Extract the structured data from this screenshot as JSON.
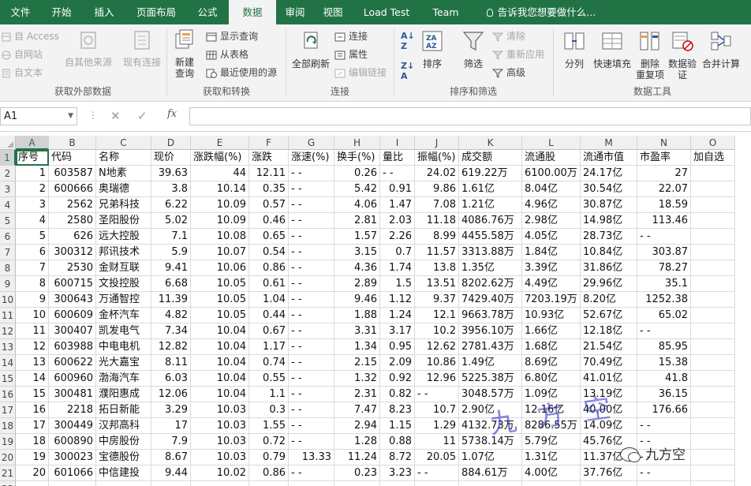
{
  "tabs": [
    "文件",
    "开始",
    "插入",
    "页面布局",
    "公式",
    "数据",
    "审阅",
    "视图",
    "Load Test",
    "Team"
  ],
  "active_tab": "数据",
  "tell_me": "告诉我您想要做什么...",
  "ribbon": {
    "get_external": {
      "access": "自 Access",
      "web": "自网站",
      "text": "自文本",
      "other_sources": "自其他来源",
      "existing_conn": "现有连接",
      "group_label": "获取外部数据"
    },
    "get_transform": {
      "new_query_line1": "新建",
      "new_query_line2": "查询",
      "show_queries": "显示查询",
      "from_table": "从表格",
      "recent_sources": "最近使用的源",
      "group_label": "获取和转换"
    },
    "connections": {
      "refresh_all": "全部刷新",
      "connections": "连接",
      "properties": "属性",
      "edit_links": "编辑链接",
      "group_label": "连接"
    },
    "sort_filter": {
      "sort": "排序",
      "filter": "筛选",
      "clear": "清除",
      "reapply": "重新应用",
      "advanced": "高级",
      "group_label": "排序和筛选"
    },
    "data_tools": {
      "text_to_columns": "分列",
      "flash_fill": "快速填充",
      "remove_dup_line1": "删除",
      "remove_dup_line2": "重复项",
      "validation_line1": "数据验",
      "validation_line2": "证",
      "consolidate": "合并计算",
      "group_label": "数据工具"
    }
  },
  "formula_bar": {
    "name_box": "A1",
    "fx": "fx",
    "formula": ""
  },
  "columns": [
    "A",
    "B",
    "C",
    "D",
    "E",
    "F",
    "G",
    "H",
    "I",
    "J",
    "K",
    "L",
    "M",
    "N",
    "O"
  ],
  "header_row": [
    "序号",
    "代码",
    "名称",
    "现价",
    "涨跌幅(%)",
    "涨跌",
    "涨速(%)",
    "换手(%)",
    "量比",
    "振幅(%)",
    "成交额",
    "流通股",
    "流通市值",
    "市盈率",
    "加自选"
  ],
  "rows": [
    [
      "1",
      "603587",
      "N地素",
      "39.63",
      "44",
      "12.11",
      "- -",
      "0.26",
      "- -",
      "24.02",
      "619.22万",
      "6100.00万",
      "24.17亿",
      "27",
      ""
    ],
    [
      "2",
      "600666",
      "奥瑞德",
      "3.8",
      "10.14",
      "0.35",
      "- -",
      "5.42",
      "0.91",
      "9.86",
      "1.61亿",
      "8.04亿",
      "30.54亿",
      "22.07",
      ""
    ],
    [
      "3",
      "2562",
      "兄弟科技",
      "6.22",
      "10.09",
      "0.57",
      "- -",
      "4.06",
      "1.47",
      "7.08",
      "1.21亿",
      "4.96亿",
      "30.87亿",
      "18.59",
      ""
    ],
    [
      "4",
      "2580",
      "圣阳股份",
      "5.02",
      "10.09",
      "0.46",
      "- -",
      "2.81",
      "2.03",
      "11.18",
      "4086.76万",
      "2.98亿",
      "14.98亿",
      "113.46",
      ""
    ],
    [
      "5",
      "626",
      "远大控股",
      "7.1",
      "10.08",
      "0.65",
      "- -",
      "1.57",
      "2.26",
      "8.99",
      "4455.58万",
      "4.05亿",
      "28.73亿",
      "- -",
      ""
    ],
    [
      "6",
      "300312",
      "邦讯技术",
      "5.9",
      "10.07",
      "0.54",
      "- -",
      "3.15",
      "0.7",
      "11.57",
      "3313.88万",
      "1.84亿",
      "10.84亿",
      "303.87",
      ""
    ],
    [
      "7",
      "2530",
      "金财互联",
      "9.41",
      "10.06",
      "0.86",
      "- -",
      "4.36",
      "1.74",
      "13.8",
      "1.35亿",
      "3.39亿",
      "31.86亿",
      "78.27",
      ""
    ],
    [
      "8",
      "600715",
      "文投控股",
      "6.68",
      "10.05",
      "0.61",
      "- -",
      "2.89",
      "1.5",
      "13.51",
      "8202.62万",
      "4.49亿",
      "29.96亿",
      "35.1",
      ""
    ],
    [
      "9",
      "300643",
      "万通智控",
      "11.39",
      "10.05",
      "1.04",
      "- -",
      "9.46",
      "1.12",
      "9.37",
      "7429.40万",
      "7203.19万",
      "8.20亿",
      "1252.38",
      ""
    ],
    [
      "10",
      "600609",
      "金杯汽车",
      "4.82",
      "10.05",
      "0.44",
      "- -",
      "1.88",
      "1.24",
      "12.1",
      "9663.78万",
      "10.93亿",
      "52.67亿",
      "65.02",
      ""
    ],
    [
      "11",
      "300407",
      "凯发电气",
      "7.34",
      "10.04",
      "0.67",
      "- -",
      "3.31",
      "3.17",
      "10.2",
      "3956.10万",
      "1.66亿",
      "12.18亿",
      "- -",
      ""
    ],
    [
      "12",
      "603988",
      "中电电机",
      "12.82",
      "10.04",
      "1.17",
      "- -",
      "1.34",
      "0.95",
      "12.62",
      "2781.43万",
      "1.68亿",
      "21.54亿",
      "85.95",
      ""
    ],
    [
      "13",
      "600622",
      "光大嘉宝",
      "8.11",
      "10.04",
      "0.74",
      "- -",
      "2.15",
      "2.09",
      "10.86",
      "1.49亿",
      "8.69亿",
      "70.49亿",
      "15.38",
      ""
    ],
    [
      "14",
      "600960",
      "渤海汽车",
      "6.03",
      "10.04",
      "0.55",
      "- -",
      "1.32",
      "0.92",
      "12.96",
      "5225.38万",
      "6.80亿",
      "41.01亿",
      "41.8",
      ""
    ],
    [
      "15",
      "300481",
      "濮阳惠成",
      "12.06",
      "10.04",
      "1.1",
      "- -",
      "2.31",
      "0.82",
      "- -",
      "3048.57万",
      "1.09亿",
      "13.19亿",
      "36.15",
      ""
    ],
    [
      "16",
      "2218",
      "拓日新能",
      "3.29",
      "10.03",
      "0.3",
      "- -",
      "7.47",
      "8.23",
      "10.7",
      "2.90亿",
      "12.16亿",
      "40.00亿",
      "176.66",
      ""
    ],
    [
      "17",
      "300449",
      "汉邦高科",
      "17",
      "10.03",
      "1.55",
      "- -",
      "2.94",
      "1.15",
      "1.29",
      "4132.73万",
      "8286.55万",
      "14.09亿",
      "- -",
      ""
    ],
    [
      "18",
      "600890",
      "中房股份",
      "7.9",
      "10.03",
      "0.72",
      "- -",
      "1.28",
      "0.88",
      "11",
      "5738.14万",
      "5.79亿",
      "45.76亿",
      "- -",
      ""
    ],
    [
      "19",
      "300023",
      "宝德股份",
      "8.67",
      "10.03",
      "0.79",
      "13.33",
      "11.24",
      "8.72",
      "20.05",
      "1.07亿",
      "1.31亿",
      "11.37亿",
      "- -",
      ""
    ],
    [
      "20",
      "601066",
      "中信建投",
      "9.44",
      "10.02",
      "0.86",
      "- -",
      "0.23",
      "3.23",
      "- -",
      "884.61万",
      "4.00亿",
      "37.76亿",
      "- -",
      ""
    ]
  ],
  "watermark": "九方空",
  "logo_text": "九方空",
  "colors": {
    "excel_green": "#217346",
    "ribbon_bg": "#f3f3f3",
    "grid_line": "#dadada"
  }
}
